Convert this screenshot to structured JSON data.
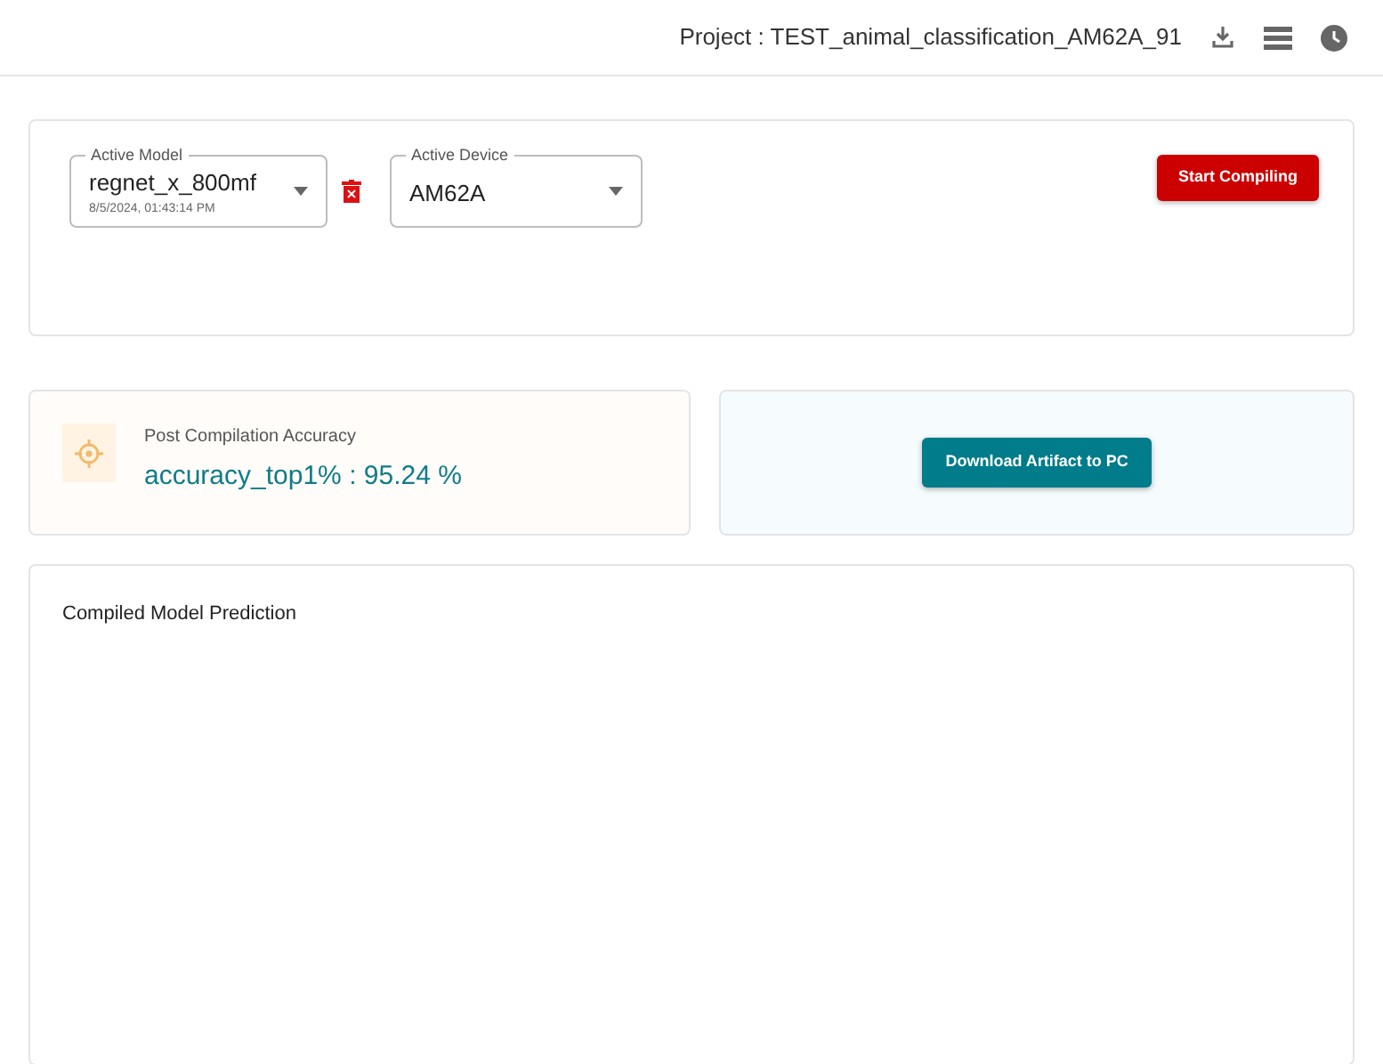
{
  "header": {
    "project_label": "Project : TEST_animal_classification_AM62A_91"
  },
  "compile_panel": {
    "model_select": {
      "label": "Active Model",
      "value": "regnet_x_800mf",
      "subtext": "8/5/2024, 01:43:14 PM"
    },
    "device_select": {
      "label": "Active Device",
      "value": "AM62A"
    },
    "start_button": "Start Compiling"
  },
  "accuracy_card": {
    "title": "Post Compilation Accuracy",
    "value": "accuracy_top1% : 95.24 %"
  },
  "download_card": {
    "button": "Download Artifact to PC"
  },
  "prediction_card": {
    "title": "Compiled Model Prediction"
  }
}
